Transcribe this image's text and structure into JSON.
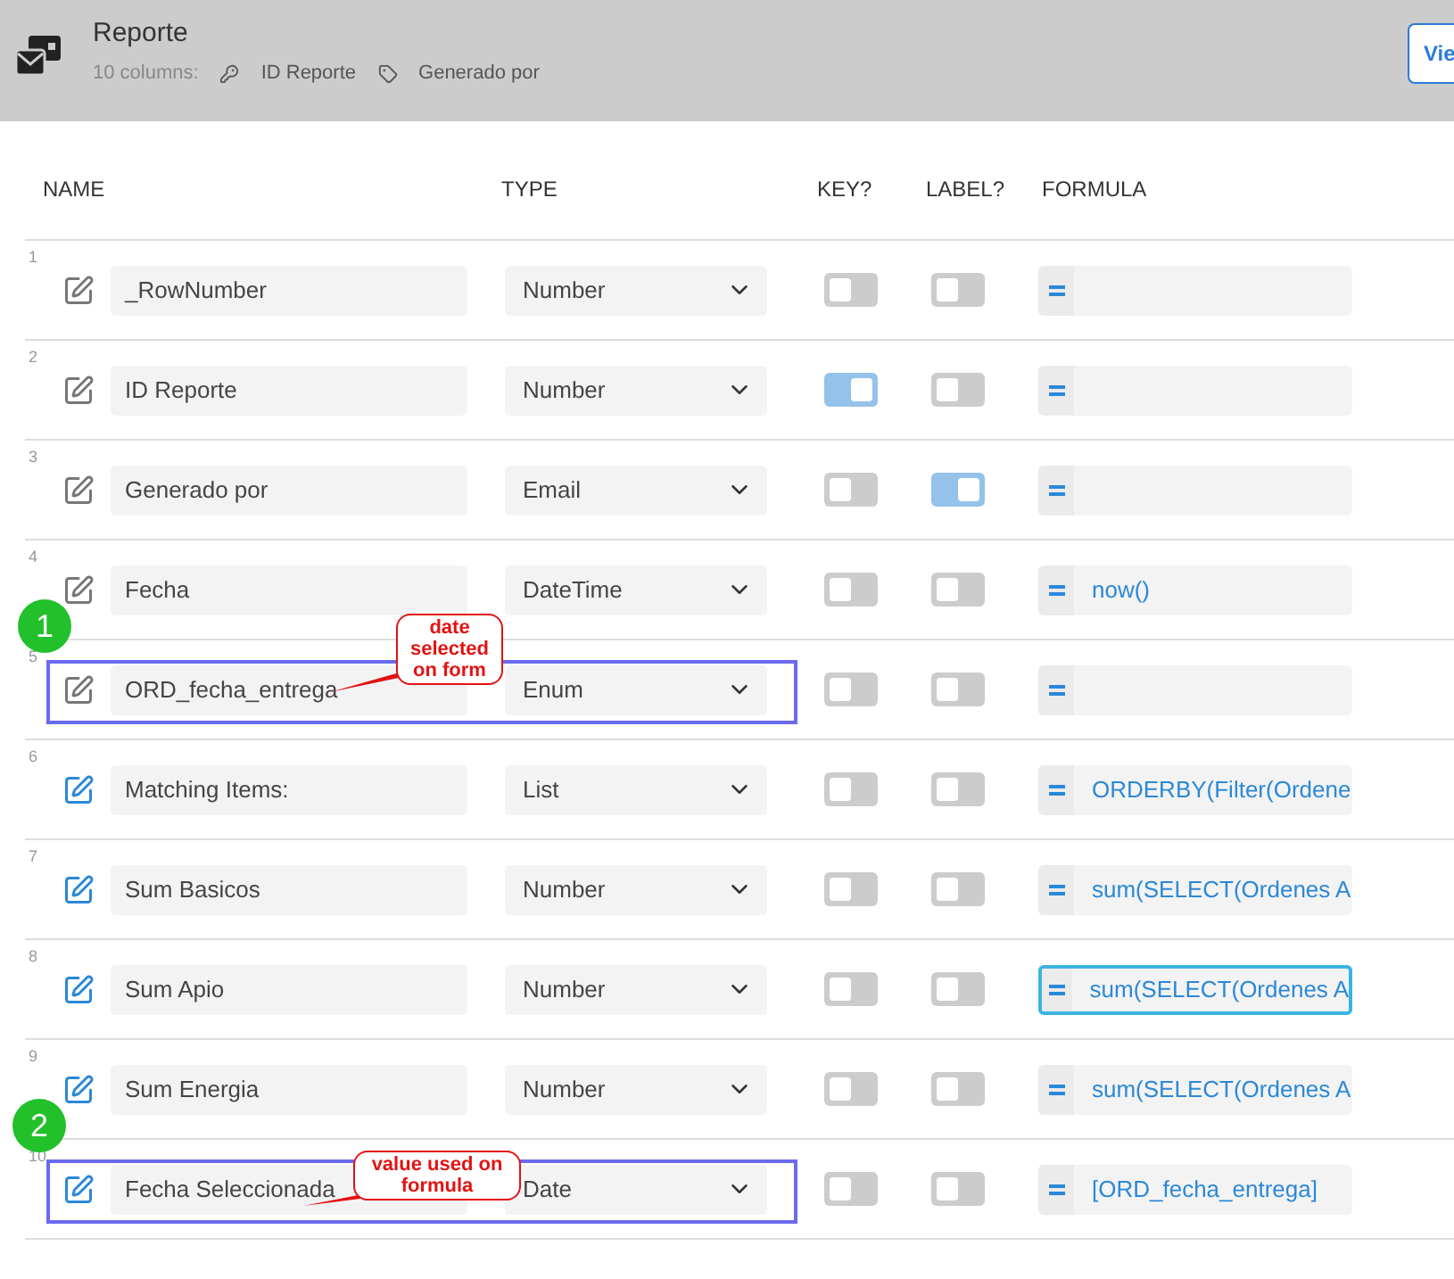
{
  "header": {
    "title": "Reporte",
    "columns_count": "10 columns:",
    "key_column": "ID Reporte",
    "label_column": "Generado por",
    "view_button": "Vie"
  },
  "table": {
    "columns": [
      "NAME",
      "TYPE",
      "KEY?",
      "LABEL?",
      "FORMULA"
    ],
    "rows": [
      {
        "number": "1",
        "name": "_RowNumber",
        "type": "Number",
        "key": false,
        "label": false,
        "formula": "",
        "virtual": false,
        "focused": false
      },
      {
        "number": "2",
        "name": "ID Reporte",
        "type": "Number",
        "key": true,
        "label": false,
        "formula": "",
        "virtual": false,
        "focused": false
      },
      {
        "number": "3",
        "name": "Generado por",
        "type": "Email",
        "key": false,
        "label": true,
        "formula": "",
        "virtual": false,
        "focused": false
      },
      {
        "number": "4",
        "name": "Fecha",
        "type": "DateTime",
        "key": false,
        "label": false,
        "formula": "now()",
        "virtual": false,
        "focused": false
      },
      {
        "number": "5",
        "name": "ORD_fecha_entrega",
        "type": "Enum",
        "key": false,
        "label": false,
        "formula": "",
        "virtual": false,
        "focused": false,
        "annotation": {
          "marker": "1",
          "note": "date selected on form"
        }
      },
      {
        "number": "6",
        "name": "Matching Items:",
        "type": "List",
        "key": false,
        "label": false,
        "formula": "ORDERBY(Filter(Ordene",
        "virtual": true,
        "focused": false
      },
      {
        "number": "7",
        "name": "Sum Basicos",
        "type": "Number",
        "key": false,
        "label": false,
        "formula": "sum(SELECT(Ordenes A",
        "virtual": true,
        "focused": false
      },
      {
        "number": "8",
        "name": "Sum Apio",
        "type": "Number",
        "key": false,
        "label": false,
        "formula": "sum(SELECT(Ordenes A",
        "virtual": true,
        "focused": true
      },
      {
        "number": "9",
        "name": "Sum Energia",
        "type": "Number",
        "key": false,
        "label": false,
        "formula": "sum(SELECT(Ordenes A",
        "virtual": true,
        "focused": false
      },
      {
        "number": "10",
        "name": "Fecha Seleccionada",
        "type": "Date",
        "key": false,
        "label": false,
        "formula": "[ORD_fecha_entrega]",
        "virtual": true,
        "focused": false,
        "annotation": {
          "marker": "2",
          "note": "value used on formula"
        }
      }
    ]
  }
}
